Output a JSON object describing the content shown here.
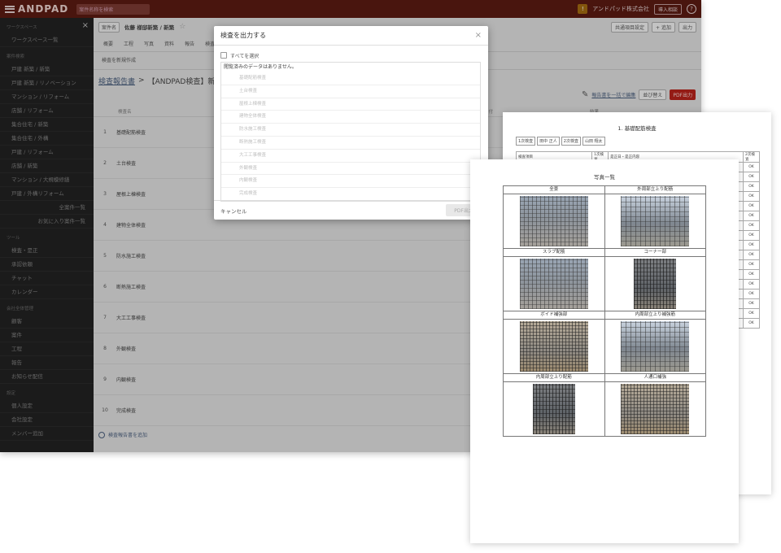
{
  "header": {
    "brand": "ANDPAD",
    "search_placeholder": "案件名称を検索",
    "notice_label": "!",
    "company_label": "アンドパッド株式会社",
    "apply_label": "導入相談",
    "help_label": "?"
  },
  "sidebar": {
    "close_label": "×",
    "sections": [
      {
        "title": "ワークスペース",
        "items": [
          {
            "label": "ワークスペース一覧",
            "align": "left"
          }
        ]
      },
      {
        "title": "案件検索",
        "items": [
          {
            "label": "戸建 新築 / 新築",
            "align": "left"
          },
          {
            "label": "戸建 新築 / リノベーション",
            "align": "left"
          },
          {
            "label": "マンション / リフォーム",
            "align": "left"
          },
          {
            "label": "店舗 / リフォーム",
            "align": "left"
          },
          {
            "label": "集合住宅 / 新築",
            "align": "left"
          },
          {
            "label": "集合住宅 / 外構",
            "align": "left"
          },
          {
            "label": "戸建 / リフォーム",
            "align": "left"
          },
          {
            "label": "店舗 / 新築",
            "align": "left"
          },
          {
            "label": "マンション / 大規模修繕",
            "align": "left"
          },
          {
            "label": "戸建 / 外構リフォーム",
            "align": "left"
          },
          {
            "label": "全案件一覧",
            "align": "right"
          },
          {
            "label": "お気に入り案件一覧",
            "align": "right"
          }
        ]
      },
      {
        "title": "ツール",
        "items": [
          {
            "label": "検査・是正",
            "align": "left"
          },
          {
            "label": "承認依頼",
            "align": "left"
          },
          {
            "label": "チャット",
            "align": "left"
          },
          {
            "label": "カレンダー",
            "align": "left"
          }
        ]
      },
      {
        "title": "会社全体管理",
        "items": [
          {
            "label": "顧客",
            "align": "left"
          },
          {
            "label": "案件",
            "align": "left"
          },
          {
            "label": "工程",
            "align": "left"
          },
          {
            "label": "報告",
            "align": "left"
          },
          {
            "label": "お知らせ配信",
            "align": "left"
          }
        ]
      },
      {
        "title": "設定",
        "items": [
          {
            "label": "個人設定",
            "align": "left"
          },
          {
            "label": "会社設定",
            "align": "left"
          },
          {
            "label": "メンバー追加",
            "align": "left"
          }
        ]
      }
    ]
  },
  "main": {
    "crumb_chip": "案件名",
    "crumb_title": "佐藤 様邸新築 / 新築",
    "star_icon": "☆",
    "crumb_actions": [
      "共通項目設定",
      "+ 追加",
      "出力"
    ],
    "tabs": [
      "概要",
      "工程",
      "写真",
      "資料",
      "報告",
      "検査"
    ],
    "subhead": "検査を新規作成",
    "report_link": "検査報告書",
    "report_title": "【ANDPAD検査】新築用",
    "edit_link": "報告書を一括で編集",
    "sort_btn": "並び替え",
    "pdf_btn": "PDF出力",
    "table_headers": {
      "name": "検査名",
      "date": "日付",
      "result": "結果"
    },
    "rows": [
      {
        "no": "1",
        "name": "基礎配筋検査"
      },
      {
        "no": "2",
        "name": "土台検査"
      },
      {
        "no": "3",
        "name": "屋根上棟検査"
      },
      {
        "no": "4",
        "name": "建物全体検査"
      },
      {
        "no": "5",
        "name": "防水施工検査"
      },
      {
        "no": "6",
        "name": "断熱施工検査"
      },
      {
        "no": "7",
        "name": "大工工事検査"
      },
      {
        "no": "8",
        "name": "外観検査"
      },
      {
        "no": "9",
        "name": "内観検査"
      },
      {
        "no": "10",
        "name": "完成検査"
      }
    ],
    "footer_link": "検査報告書を追加"
  },
  "modal": {
    "title": "検査を出力する",
    "close_label": "×",
    "select_all": "すべてを選択",
    "message": "閲覧済みのデータはありません。",
    "items": [
      "基礎配筋検査",
      "土台検査",
      "屋根上棟検査",
      "建物全体検査",
      "防水施工検査",
      "断熱施工検査",
      "大工工事検査",
      "外観検査",
      "内観検査",
      "完成検査"
    ],
    "cancel": "キャンセル",
    "pdf": "PDF出力"
  },
  "paper_back": {
    "title": "1. 基礎配筋検査",
    "chips": [
      "1次検査",
      "田中 正人",
      "2次検査",
      "山田 翔太"
    ],
    "table_head": [
      "検査項目",
      "1次検査",
      "是正日・是正内容",
      "2次検査"
    ],
    "results": [
      "OK",
      "OK",
      "OK",
      "OK",
      "OK",
      "OK",
      "OK",
      "OK",
      "OK",
      "OK",
      "OK",
      "OK",
      "OK",
      "OK",
      "OK",
      "OK",
      "OK"
    ]
  },
  "paper_front": {
    "title": "写真一覧",
    "captions": [
      "全景",
      "外周部立上り配筋",
      "スラブ配筋",
      "コーナー部",
      "ボイド補強部",
      "内周部立上り補強筋",
      "内周部立上り配筋",
      "人通口補強"
    ]
  }
}
